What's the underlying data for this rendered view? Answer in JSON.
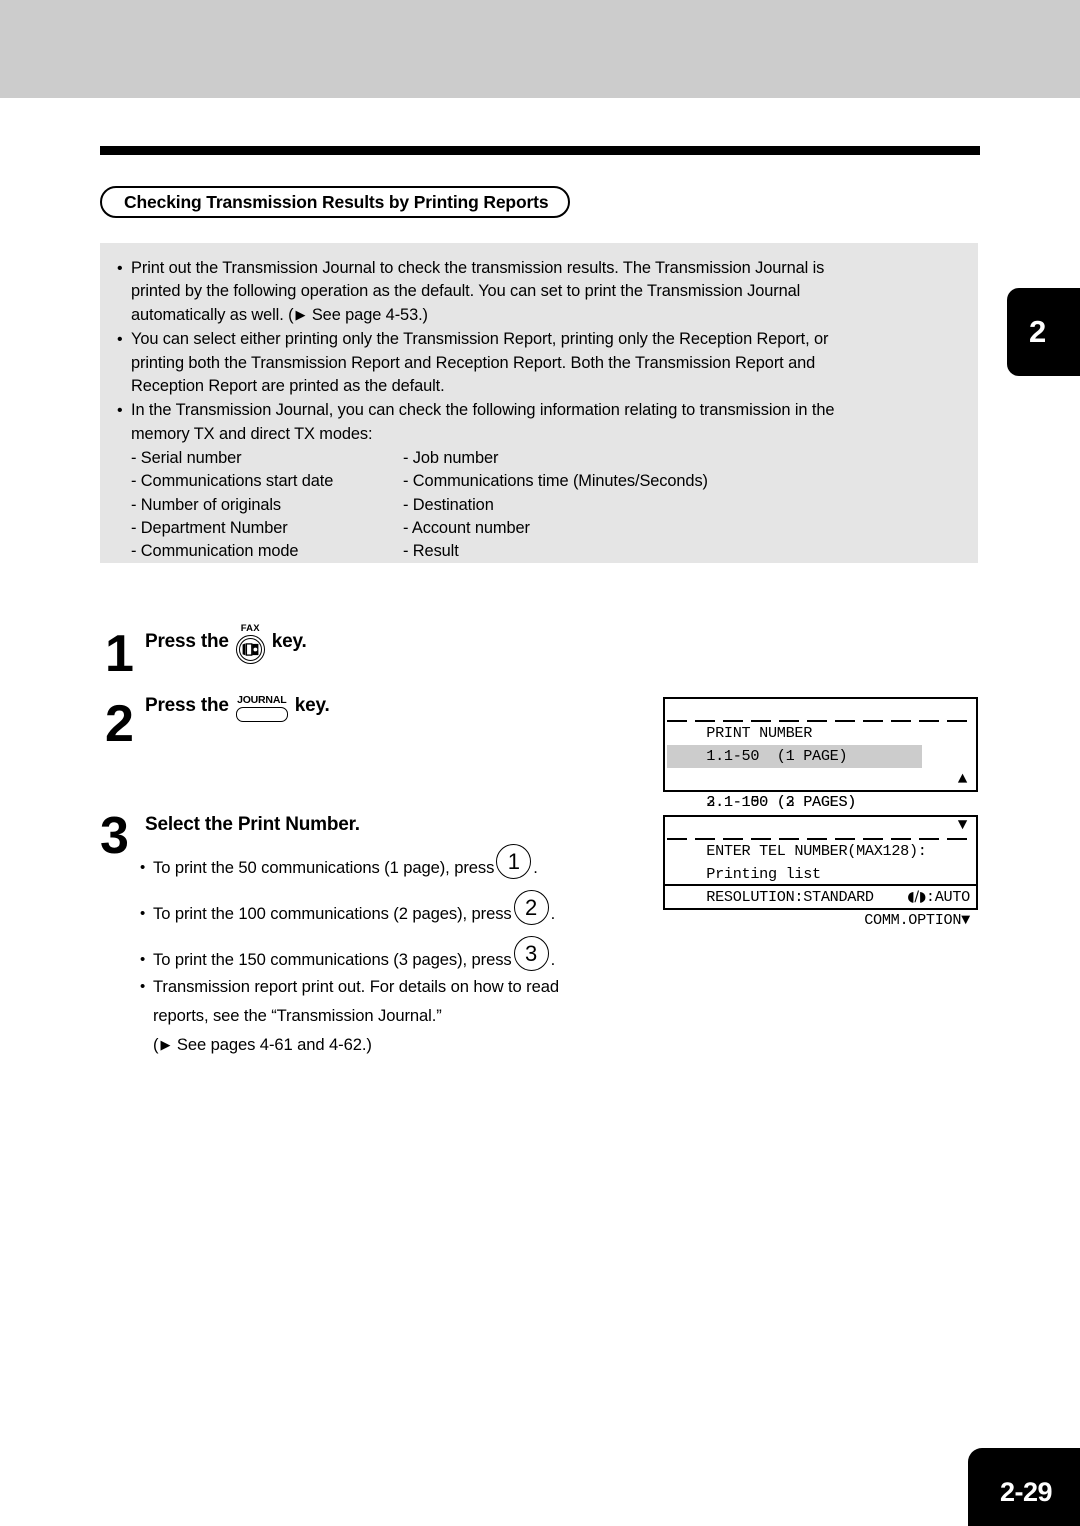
{
  "chapter_tab": "2",
  "page_number": "2-29",
  "title": "Checking Transmission Results by Printing Reports",
  "intro": {
    "bullets": [
      {
        "lines": [
          "Print out the Transmission Journal to check the transmission results.  The Transmission Journal is",
          "printed by the following operation as the default.  You can set to print the Transmission Journal",
          "automatically as well. ("
        ],
        "tail": " See page 4-53.)"
      },
      {
        "lines": [
          "You can select either printing only the Transmission Report, printing only the Reception Report, or",
          "printing both the Transmission Report and Reception Report.  Both the Transmission Report and",
          "Reception Report are printed as the default."
        ]
      },
      {
        "lines": [
          "In the Transmission Journal, you can check the following information relating to transmission in the",
          "memory TX and direct TX modes:"
        ]
      }
    ],
    "sublist": [
      {
        "left": "- Serial number",
        "right": "- Job number"
      },
      {
        "left": "- Communications start date",
        "right": "- Communications time (Minutes/Seconds)"
      },
      {
        "left": "- Number of originals",
        "right": "- Destination"
      },
      {
        "left": "- Department Number",
        "right": "- Account number"
      },
      {
        "left": "- Communication mode",
        "right": "- Result"
      }
    ]
  },
  "steps": {
    "step1": {
      "number": "1",
      "text_before": "Press the",
      "key_label": "FAX",
      "text_after": "key."
    },
    "step2": {
      "number": "2",
      "text_before": "Press the",
      "key_label": "JOURNAL",
      "text_after": "key."
    },
    "step3": {
      "number": "3",
      "heading": "Select the Print Number.",
      "options": [
        {
          "text_before": "To print the 50 communications (1 page), press",
          "key": "1",
          "text_after": "."
        },
        {
          "text_before": "To print the 100 communications (2 pages), press",
          "key": "2",
          "text_after": "."
        },
        {
          "text_before": "To print the 150 communications (3 pages), press",
          "key": "3",
          "text_after": "."
        }
      ],
      "note": {
        "line1": "Transmission report print out. For details on how to read",
        "line2": "reports, see the “Transmission Journal.”",
        "line3_open": "(",
        "line3_rest": " See pages 4-61 and 4-62.)"
      }
    }
  },
  "lcd_print_number": {
    "header": "PRINT NUMBER",
    "rows": [
      {
        "text": "1.1-50  (1 PAGE)",
        "arrow": "▲",
        "highlighted": false
      },
      {
        "text": "2.1-100 (2 PAGES)",
        "arrow": "",
        "highlighted": true
      },
      {
        "text": "3.1-150 (3 PAGES)",
        "arrow": "▼",
        "highlighted": false
      }
    ]
  },
  "lcd_enter_tel": {
    "header": "ENTER TEL NUMBER(MAX128):",
    "line2": "Printing list",
    "line3_left": "RESOLUTION:STANDARD",
    "line3_icons": "◖/◗",
    "line3_right": ":AUTO",
    "line4": "COMM.OPTION",
    "line4_arrow": "▼"
  },
  "icons": {
    "triangle_right": "▶"
  }
}
